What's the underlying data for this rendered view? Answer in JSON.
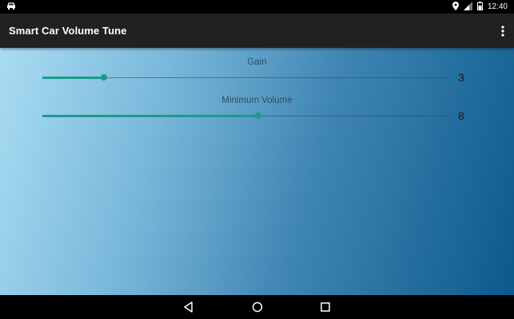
{
  "status_bar": {
    "time": "12:40",
    "icons": [
      "car-notification-icon",
      "location-icon",
      "signal-icon",
      "battery-icon"
    ]
  },
  "app_bar": {
    "title": "Smart Car Volume Tune",
    "menu_icon": "more-vert-icon"
  },
  "settings": [
    {
      "label": "Gain",
      "value": "3",
      "slider_fraction": 0.15
    },
    {
      "label": "Minimum Volume",
      "value": "8",
      "slider_fraction": 0.53
    }
  ],
  "nav_bar": {
    "icons": [
      "back-icon",
      "home-icon",
      "recents-icon"
    ]
  },
  "colors": {
    "accent": "#1d9a8c",
    "app_bar": "#212121",
    "gradient_start": "#a9dcf2",
    "gradient_end": "#0b5a8c"
  }
}
